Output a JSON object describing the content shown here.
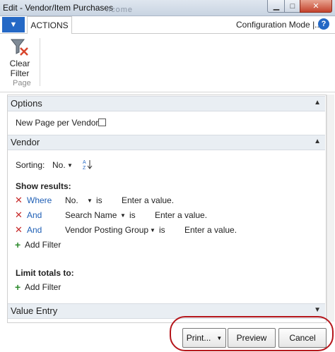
{
  "window": {
    "title": "Edit - Vendor/Item Purchases",
    "ghost_text": "ncome"
  },
  "ribbon": {
    "app_menu_glyph": "▼",
    "tab_actions": "ACTIONS",
    "configuration_mode": "Configuration Mode |...",
    "help_glyph": "?",
    "clear_filter_label_1": "Clear",
    "clear_filter_label_2": "Filter",
    "group_label": "Page"
  },
  "options": {
    "header": "Options",
    "new_page_label": "New Page per Vendor:",
    "new_page_checked": false
  },
  "vendor": {
    "header": "Vendor",
    "sorting_label": "Sorting:",
    "sorting_value": "No.",
    "show_results": "Show results:",
    "filters": [
      {
        "conj": "Where",
        "field": "No.",
        "op": "is",
        "value": "Enter a value."
      },
      {
        "conj": "And",
        "field": "Search Name",
        "op": "is",
        "value": "Enter a value."
      },
      {
        "conj": "And",
        "field": "Vendor Posting Group",
        "op": "is",
        "value": "Enter a value."
      }
    ],
    "add_filter": "Add Filter",
    "limit_totals": "Limit totals to:",
    "add_filter_2": "Add Filter"
  },
  "value_entry": {
    "header": "Value Entry"
  },
  "footer": {
    "print": "Print...",
    "preview": "Preview",
    "cancel": "Cancel"
  },
  "colors": {
    "accent": "#2468c5",
    "link": "#1f5fb5",
    "remove": "#c62828",
    "add": "#2e8b2e",
    "annotation": "#b5161b"
  }
}
